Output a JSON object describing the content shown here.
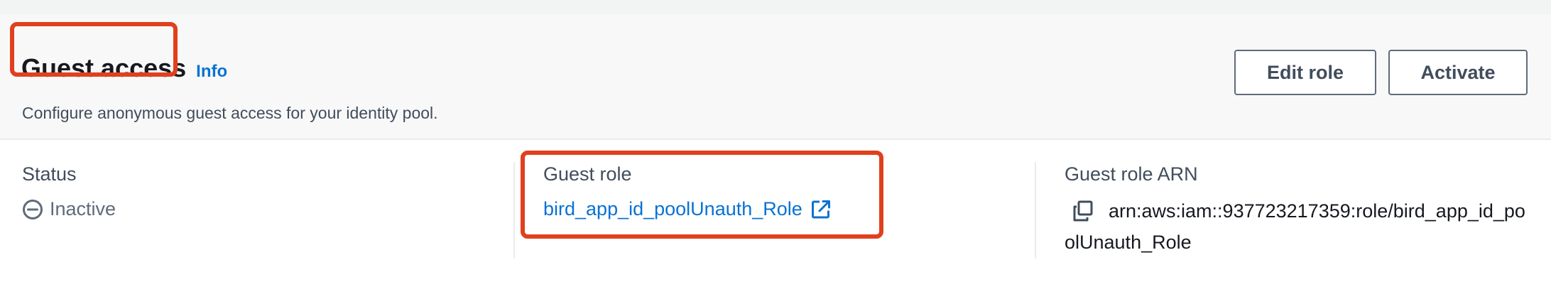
{
  "header": {
    "title": "Guest access",
    "info_link": "Info",
    "description": "Configure anonymous guest access for your identity pool.",
    "edit_button": "Edit role",
    "activate_button": "Activate"
  },
  "details": {
    "status": {
      "label": "Status",
      "value": "Inactive",
      "icon": "minus-circle-icon"
    },
    "guest_role": {
      "label": "Guest role",
      "value": "bird_app_id_poolUnauth_Role",
      "icon": "external-link-icon"
    },
    "guest_role_arn": {
      "label": "Guest role ARN",
      "value": "arn:aws:iam::937723217359:role/bird_app_id_poolUnauth_Role",
      "icon": "copy-icon"
    }
  },
  "colors": {
    "link": "#0972d3",
    "highlight": "#e0401e",
    "header_bg": "#f8f8f8",
    "text": "#16191f",
    "muted": "#5f6b7a"
  }
}
